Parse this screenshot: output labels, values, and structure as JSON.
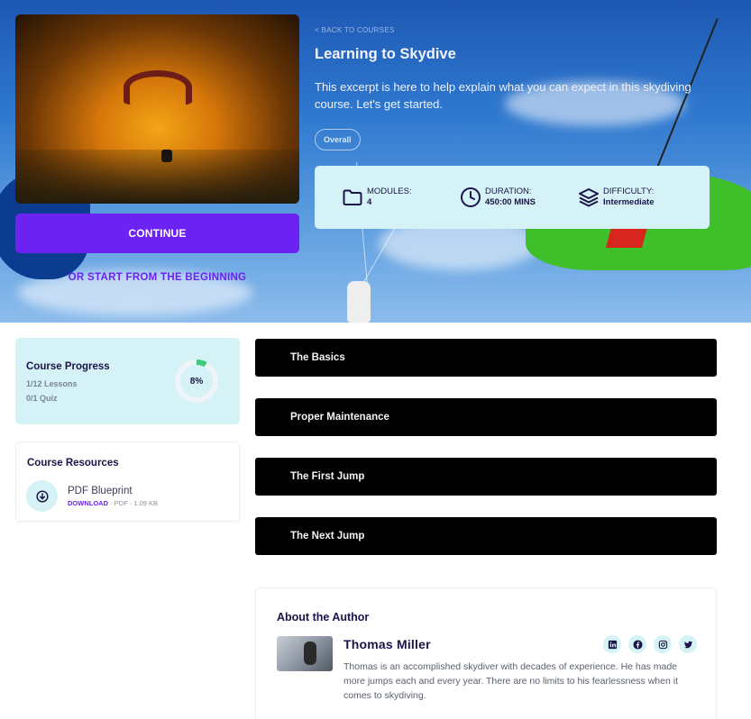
{
  "hero": {
    "back_link": "< BACK TO COURSES",
    "title": "Learning to Skydive",
    "description": "This excerpt is here to help explain what you can expect in this skydiving course. Let's get started.",
    "level": "Overall",
    "continue_label": "CONTINUE",
    "restart_label": "OR START FROM THE BEGINNING"
  },
  "stats": [
    {
      "label": "MODULES:",
      "value": "4",
      "icon": "folder-icon"
    },
    {
      "label": "DURATION:",
      "value": "450:00 MINS",
      "icon": "clock-icon"
    },
    {
      "label": "DIFFICULTY:",
      "value": "Intermediate",
      "icon": "layers-icon"
    }
  ],
  "progress": {
    "title": "Course Progress",
    "lessons": "1/12 Lessons",
    "quiz": "0/1 Quiz",
    "percent_label": "8%",
    "percent": 8,
    "ring_color": "#3ecb7e",
    "track_color": "#eef4f8"
  },
  "resources": {
    "title": "Course Resources",
    "items": [
      {
        "name": "PDF Blueprint",
        "action": "DOWNLOAD",
        "meta": " · PDF · 1.09 KB",
        "icon": "download-icon"
      }
    ]
  },
  "modules": [
    {
      "title": "The Basics"
    },
    {
      "title": "Proper Maintenance"
    },
    {
      "title": "The First Jump"
    },
    {
      "title": "The Next Jump"
    }
  ],
  "author": {
    "heading": "About the Author",
    "name": "Thomas Miller",
    "bio": "Thomas is an accomplished skydiver with decades of experience. He has made more jumps each and every year. There are no limits to his fearlessness when it comes to skydiving.",
    "social": [
      "linkedin-icon",
      "facebook-icon",
      "instagram-icon",
      "twitter-icon"
    ]
  },
  "colors": {
    "accent": "#6b22f2",
    "panel": "#d5f2f6",
    "navy": "#1b1448"
  }
}
